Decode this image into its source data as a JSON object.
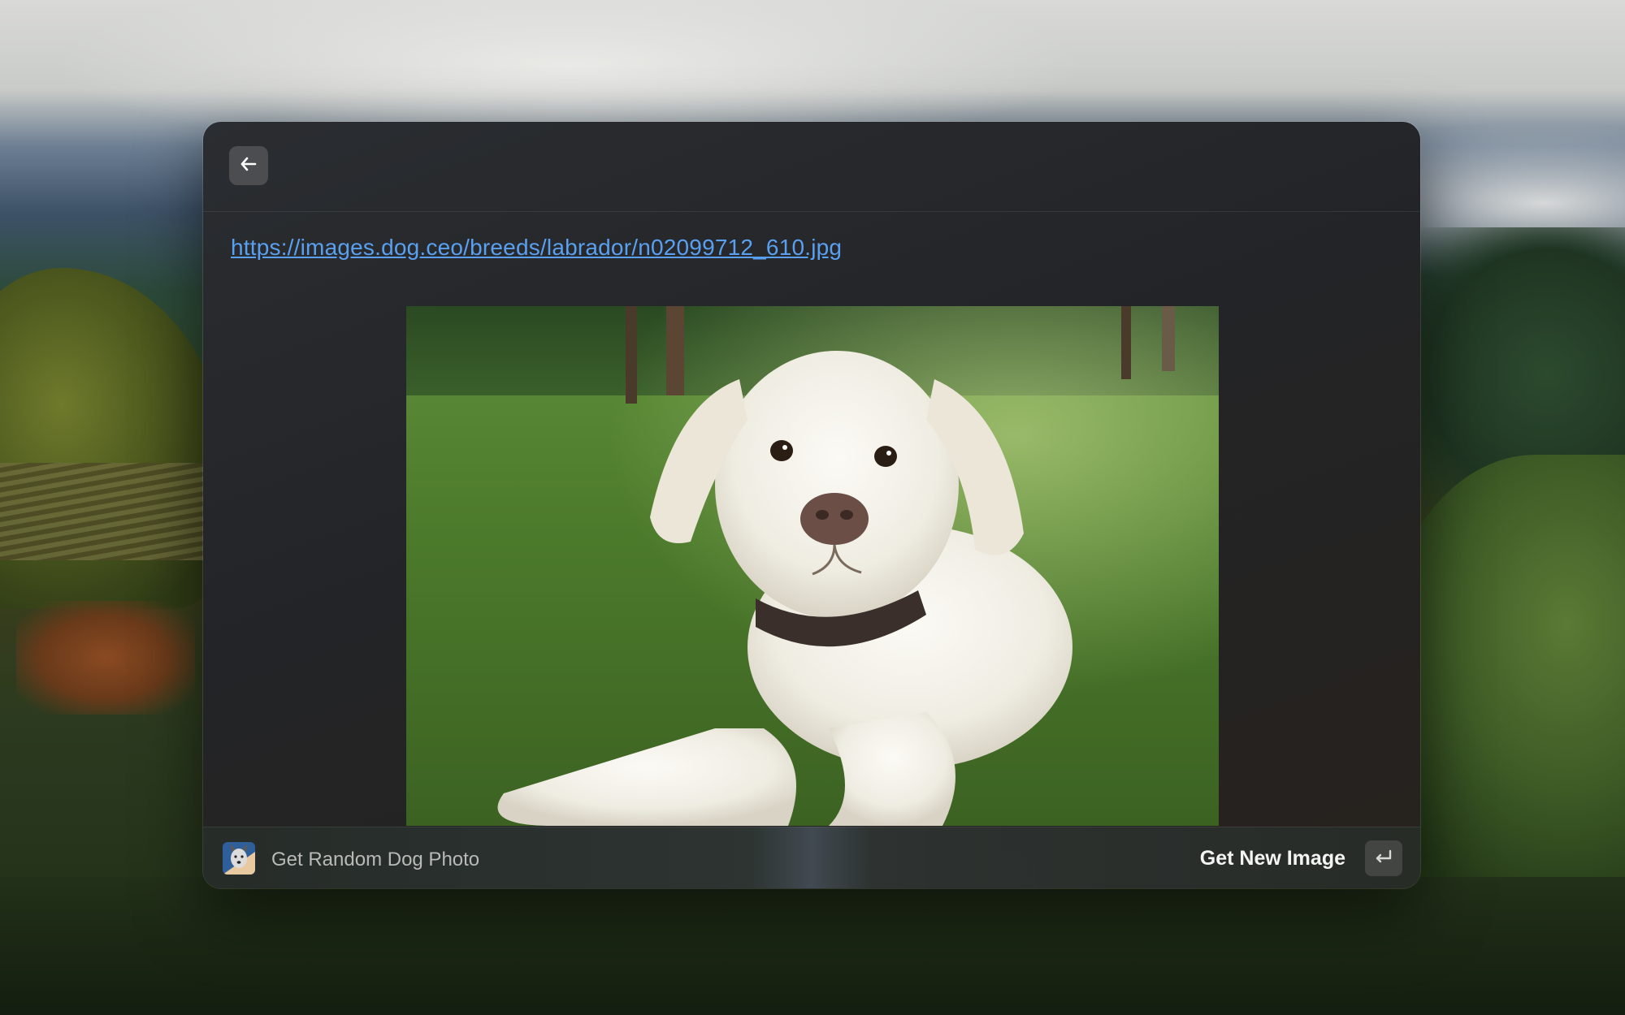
{
  "window": {
    "back_button_icon": "arrow-left-icon",
    "image_url": "https://images.dog.ceo/breeds/labrador/n02099712_610.jpg",
    "photo_alt": "Labrador puppy lying on grass"
  },
  "bottom_bar": {
    "extension_icon": "dog-icon",
    "extension_title": "Get Random Dog Photo",
    "primary_action": "Get New Image",
    "shortcut_icon": "enter-key-icon"
  },
  "colors": {
    "link": "#5aa0f0",
    "window_bg": "#232427",
    "action_text": "#f4f4f4"
  }
}
